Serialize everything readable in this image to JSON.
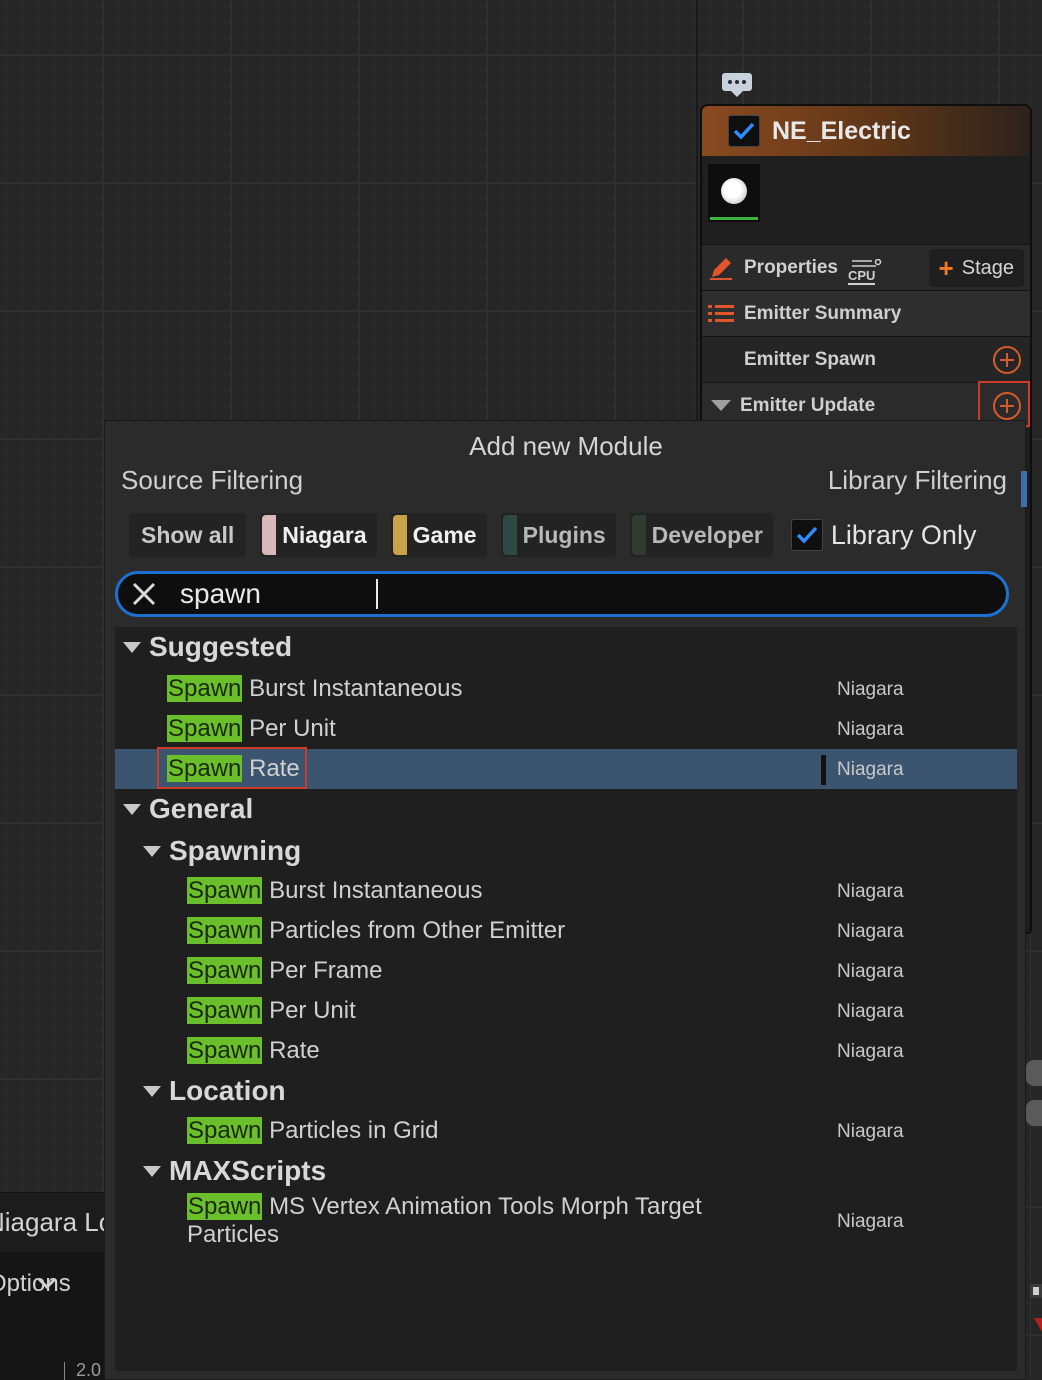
{
  "graph": {
    "log_tab_label": "Niagara Log",
    "bottom_dropdown_label": "Options",
    "timeline_tick": "2.0"
  },
  "node": {
    "title": "NE_Electric",
    "enabled": true,
    "properties_label": "Properties",
    "cpu_badge": "CPU",
    "stage_button": "Stage",
    "emitter_summary": "Emitter Summary",
    "emitter_spawn": "Emitter Spawn",
    "emitter_update": "Emitter Update"
  },
  "popup": {
    "title": "Add new Module",
    "source_filtering": "Source Filtering",
    "library_filtering": "Library Filtering",
    "filters": {
      "show_all": "Show all",
      "niagara": "Niagara",
      "game": "Game",
      "plugins": "Plugins",
      "developer": "Developer",
      "library_only": "Library Only"
    },
    "filter_colors": {
      "niagara": "#d9b8b8",
      "game": "#c9a24a",
      "plugins": "#2f4a44",
      "developer": "#2f3d30"
    },
    "search": {
      "value": "spawn"
    },
    "categories": {
      "suggested": "Suggested",
      "general": "General",
      "spawning": "Spawning",
      "location": "Location",
      "maxscripts": "MAXScripts"
    },
    "match": "Spawn",
    "items": [
      {
        "rest": "Burst Instantaneous",
        "source": "Niagara"
      },
      {
        "rest": "Per Unit",
        "source": "Niagara"
      },
      {
        "rest": "Rate",
        "source": "Niagara",
        "selected": true
      },
      {
        "rest": "Burst Instantaneous",
        "source": "Niagara"
      },
      {
        "rest": "Particles from Other Emitter",
        "source": "Niagara"
      },
      {
        "rest": "Per Frame",
        "source": "Niagara"
      },
      {
        "rest": "Per Unit",
        "source": "Niagara"
      },
      {
        "rest": "Rate",
        "source": "Niagara"
      },
      {
        "rest": "Particles in Grid",
        "source": "Niagara"
      },
      {
        "rest": "MS Vertex Animation Tools Morph Target Particles",
        "source": "Niagara"
      }
    ]
  }
}
